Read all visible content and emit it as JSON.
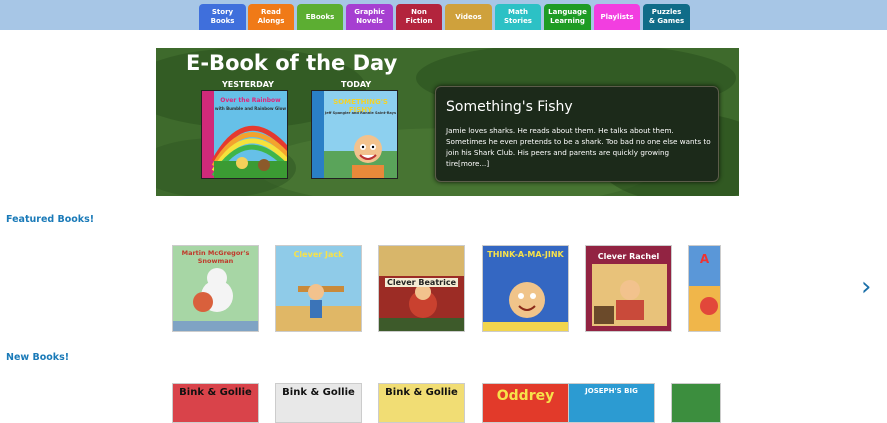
{
  "nav": {
    "tabs": [
      {
        "label": "Story\nBooks",
        "color": "#3f6fdc"
      },
      {
        "label": "Read\nAlongs",
        "color": "#f07a17"
      },
      {
        "label": "EBooks",
        "color": "#5cae32"
      },
      {
        "label": "Graphic\nNovels",
        "color": "#a63fd1"
      },
      {
        "label": "Non\nFiction",
        "color": "#b3243d"
      },
      {
        "label": "Videos",
        "color": "#cfa13c"
      },
      {
        "label": "Math\nStories",
        "color": "#2cc1c5"
      },
      {
        "label": "Language\nLearning",
        "color": "#1e9c24"
      },
      {
        "label": "Playlists",
        "color": "#f23ee0"
      },
      {
        "label": "Puzzles\n& Games",
        "color": "#0f6c88"
      }
    ]
  },
  "hero": {
    "title": "E-Book of the Day",
    "yesterday_label": "YESTERDAY",
    "today_label": "TODAY",
    "yesterday_book_title": "Over the Rainbow",
    "yesterday_book_subtitle": "with Bumble and Rainbow Glow",
    "today_book_title": "SOMETHING'S FISHY",
    "today_book_authors": "Jeff Spangler and Ronnie Saint-Rays",
    "panel_title": "Something's Fishy",
    "panel_text": "Jamie loves sharks. He reads about them. He talks about them. Sometimes he even pretends to be a shark. Too bad no one else wants to join his Shark Club. His peers and parents are quickly growing tire",
    "more_link": "[more...]"
  },
  "featured": {
    "heading": "Featured Books!",
    "books": [
      {
        "title": "Martin McGregor's Snowman",
        "bg": "#9bd1a0"
      },
      {
        "title": "Clever Jack",
        "bg": "#7ec4e6"
      },
      {
        "title": "Clever Beatrice",
        "bg": "#a4302a"
      },
      {
        "title": "THINK-A-MA-JINK",
        "bg": "#2a5ab6"
      },
      {
        "title": "Clever Rachel",
        "bg": "#8a1d38"
      },
      {
        "title": "A",
        "bg": "#4f8fd6"
      }
    ]
  },
  "new_books": {
    "heading": "New Books!",
    "books": [
      {
        "title": "Bink & Gollie",
        "bg": "#d9434a"
      },
      {
        "title": "Bink & Gollie",
        "bg": "#e8e8e8"
      },
      {
        "title": "Bink & Gollie",
        "bg": "#f1dd74"
      },
      {
        "title": "Oddrey",
        "bg": "#e23a2a"
      },
      {
        "title": "JOSEPH'S BIG",
        "bg": "#2c9bd2"
      },
      {
        "title": "",
        "bg": "#3c8e3e"
      }
    ]
  },
  "icons": {
    "next": "chevron-right-icon"
  }
}
